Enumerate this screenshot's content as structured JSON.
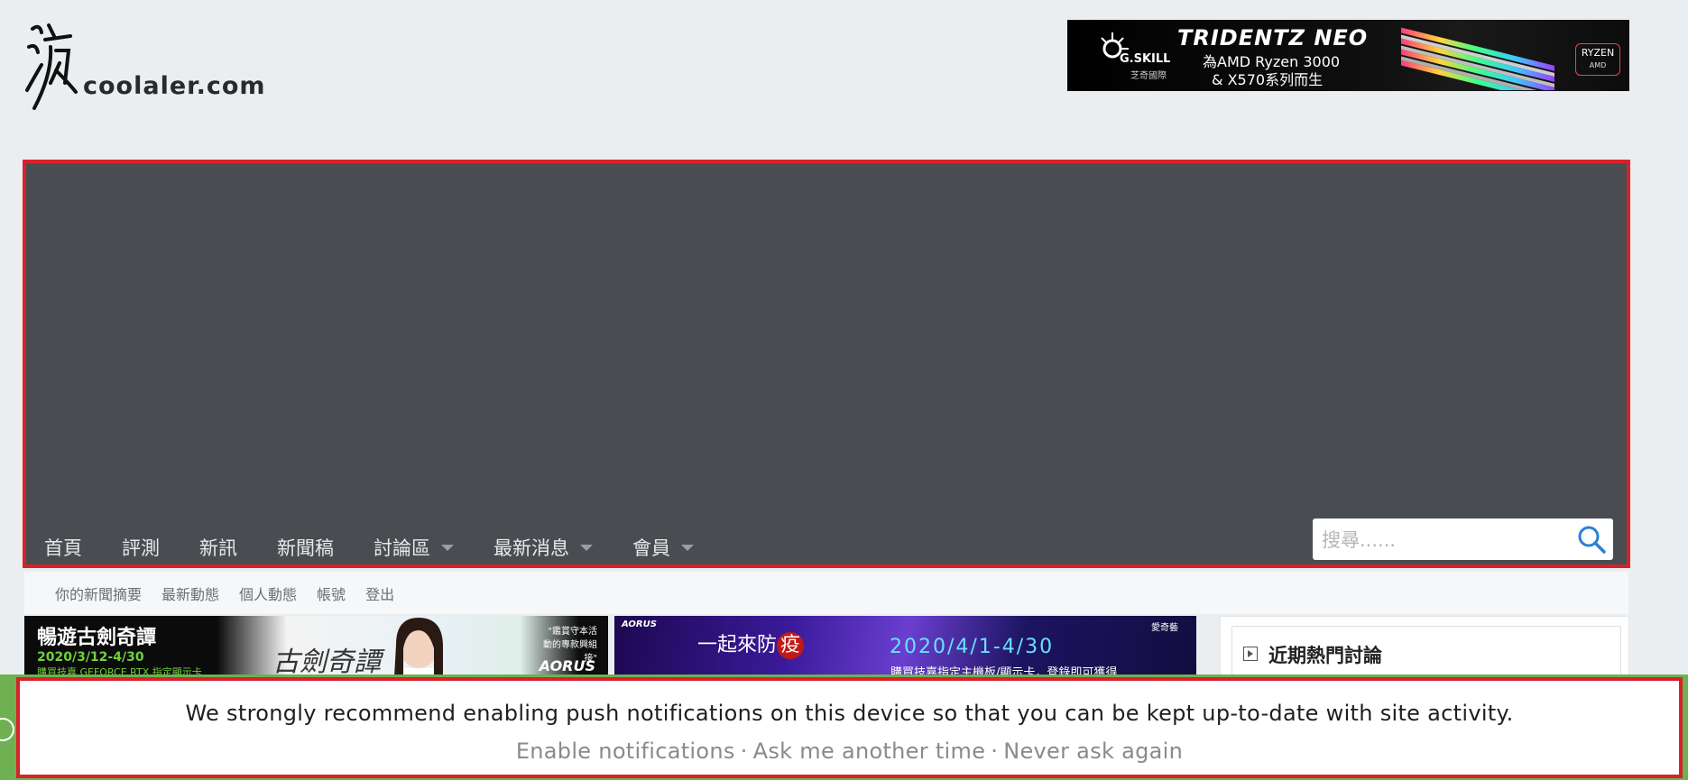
{
  "logo": {
    "text": "coolaler.com",
    "icon": "brush-calligraphy-logo"
  },
  "top_ad": {
    "brand": "G.SKILL",
    "brand_sub": "芝奇國際",
    "title": "TRIDENTZ NEO",
    "line1": "為AMD Ryzen 3000",
    "line2": "& X570系列而生",
    "badge": "RYZEN",
    "badge_sub": "AMD"
  },
  "nav": {
    "items": [
      {
        "label": "首頁",
        "has_menu": false
      },
      {
        "label": "評測",
        "has_menu": false
      },
      {
        "label": "新訊",
        "has_menu": false
      },
      {
        "label": "新聞稿",
        "has_menu": false
      },
      {
        "label": "討論區",
        "has_menu": true
      },
      {
        "label": "最新消息",
        "has_menu": true
      },
      {
        "label": "會員",
        "has_menu": true
      }
    ],
    "search_placeholder": "搜尋......"
  },
  "subnav": {
    "items": [
      "你的新聞摘要",
      "最新動態",
      "個人動態",
      "帳號",
      "登出"
    ]
  },
  "banner1": {
    "title": "暢遊古劍奇譚",
    "date": "2020/3/12-4/30",
    "note": "購買技嘉 GEFORCE RTX 指定顯示卡",
    "tag": "\"鑑賞守本活動的專款興組接\"",
    "script": "古劍奇譚",
    "brand": "AORUS"
  },
  "banner2": {
    "brand": "AORUS",
    "title_pre": "一起來防",
    "title_circle": "疫",
    "date": "2020/4/1-4/30",
    "sub": "購買技嘉指定主機板/顯示卡，登錄即可獲得",
    "logo": "愛奇藝"
  },
  "sidebar": {
    "widget_title": "近期熱門討論"
  },
  "notification": {
    "message": "We strongly recommend enabling push notifications on this device so that you can be kept up-to-date with site activity.",
    "enable": "Enable notifications",
    "later": "Ask me another time",
    "never": "Never ask again",
    "separator": "·"
  },
  "colors": {
    "page_bg": "#ebeef1",
    "header_bg": "#494d51",
    "highlight_border": "#d7222a",
    "notice_bar": "#6fb052",
    "search_icon": "#2b7fd4"
  }
}
